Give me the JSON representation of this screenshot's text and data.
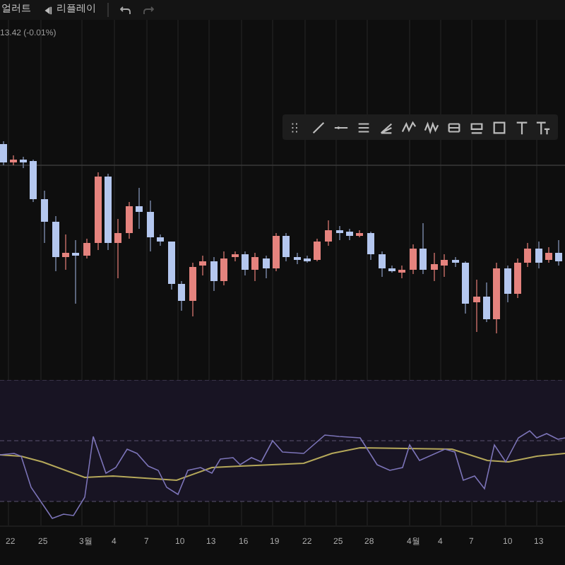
{
  "toolbar": {
    "items": [
      {
        "label": "얼러트",
        "kind": "text"
      },
      {
        "label": "리플레이",
        "kind": "replay"
      }
    ]
  },
  "legend": {
    "value": "13.42 (-0.01%)"
  },
  "x_axis": {
    "labels": [
      "22",
      "25",
      "3월",
      "4",
      "7",
      "10",
      "13",
      "16",
      "19",
      "22",
      "25",
      "28",
      "4월",
      "4",
      "7",
      "10",
      "13"
    ]
  }
}
